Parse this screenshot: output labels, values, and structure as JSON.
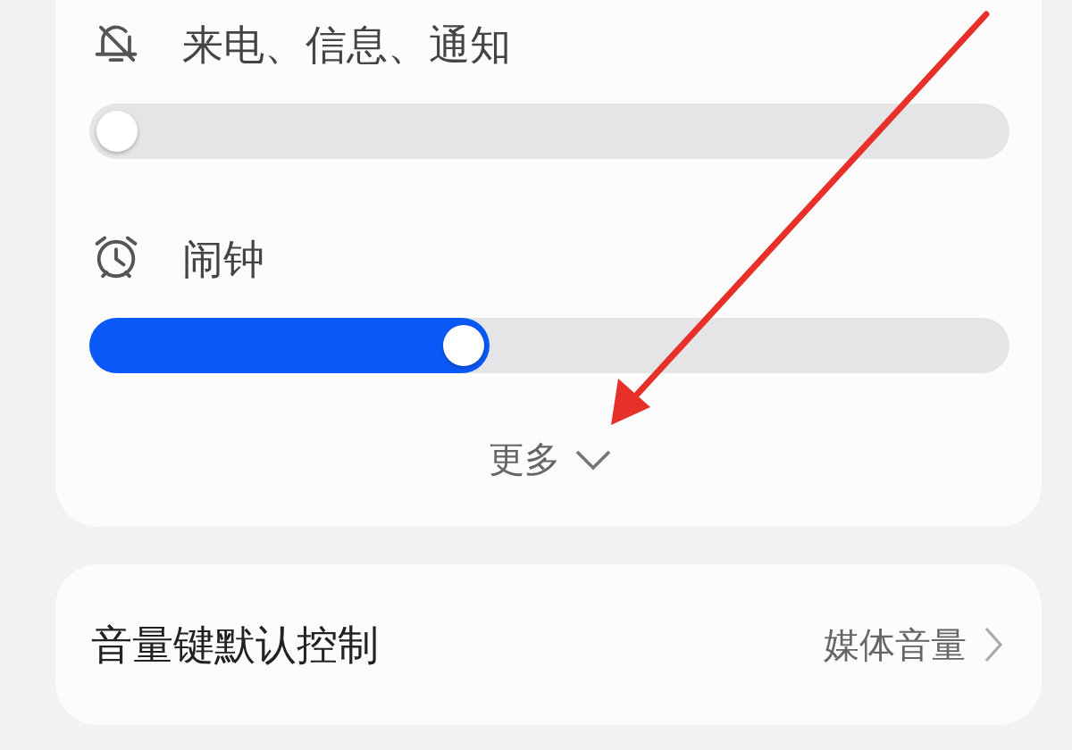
{
  "volume_card": {
    "sliders": [
      {
        "label": "来电、信息、通知",
        "level": 0
      },
      {
        "label": "闹钟",
        "level": 0.4
      }
    ],
    "more": {
      "label": "更多",
      "expanded": false
    }
  },
  "settings": [
    {
      "label": "音量键默认控制",
      "value": "媒体音量"
    }
  ]
}
